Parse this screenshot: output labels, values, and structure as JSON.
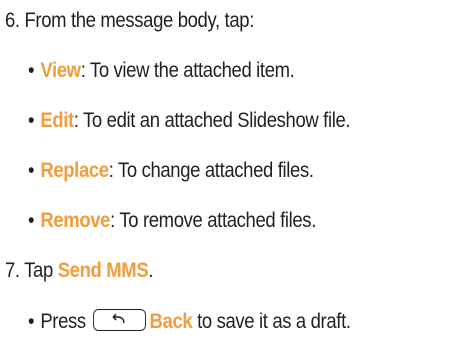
{
  "step6": {
    "text": "6. From the message body, tap:",
    "options": [
      {
        "keyword": "View",
        "desc": ": To view the attached item."
      },
      {
        "keyword": "Edit",
        "desc": ": To edit an attached Slideshow file."
      },
      {
        "keyword": "Replace",
        "desc": ": To change attached files."
      },
      {
        "keyword": "Remove",
        "desc": ": To remove attached files."
      }
    ]
  },
  "step7": {
    "prefix": "7. Tap ",
    "keyword": "Send MMS",
    "suffix": "."
  },
  "note": {
    "prefix": "Press ",
    "key_icon": "back-arrow-icon",
    "keyword": "Back",
    "suffix": " to save it as a draft."
  },
  "bullet_char": "•",
  "colors": {
    "accent": "#f39c3c",
    "text": "#231f20"
  }
}
